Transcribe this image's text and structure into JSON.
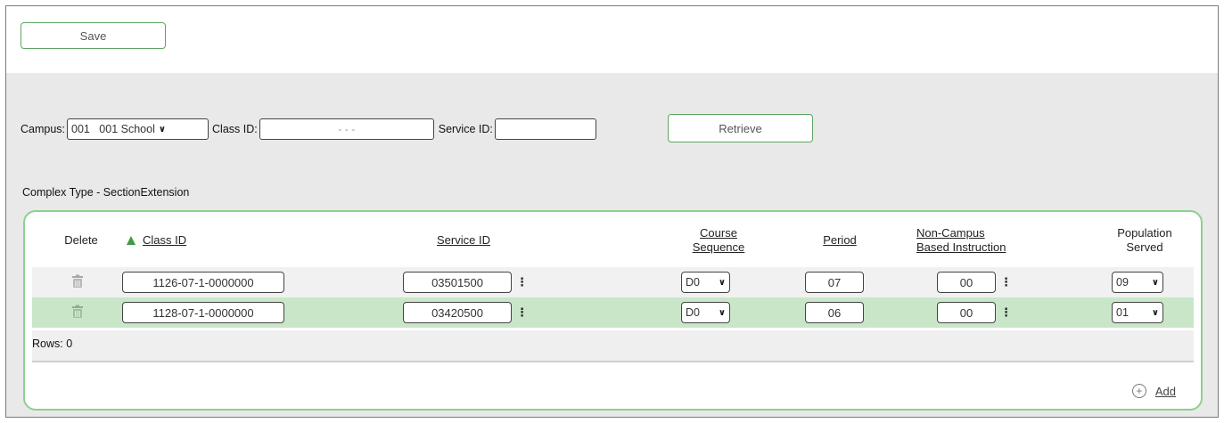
{
  "toolbar": {
    "save_label": "Save"
  },
  "filters": {
    "campus_label": "Campus:",
    "campus_value": "001   001 School",
    "class_id_label": "Class ID:",
    "class_id_placeholder": "- - -",
    "service_id_label": "Service ID:",
    "service_id_value": "",
    "retrieve_label": "Retrieve"
  },
  "section_title": "Complex Type - SectionExtension",
  "table": {
    "headers": {
      "delete": "Delete",
      "class_id": "Class ID",
      "service_id": "Service ID",
      "course_sequence_1": "Course",
      "course_sequence_2": "Sequence",
      "period": "Period",
      "non_campus_1": "Non-Campus",
      "non_campus_2": "Based Instruction",
      "population_1": "Population",
      "population_2": "Served"
    },
    "sort_indicator": "ascending",
    "rows": [
      {
        "class_id": "1126-07-1-0000000",
        "service_id": "03501500",
        "course_sequence": "D0",
        "period": "07",
        "non_campus": "00",
        "population_served": "09"
      },
      {
        "class_id": "1128-07-1-0000000",
        "service_id": "03420500",
        "course_sequence": "D0",
        "period": "06",
        "non_campus": "00",
        "population_served": "01"
      }
    ],
    "rows_label": "Rows: 0",
    "add_label": "Add"
  },
  "icons": {
    "trash": "trash-icon",
    "dots": "vertical-ellipsis-icon",
    "chevron": "chevron-down-icon",
    "add": "plus-circle-icon",
    "sort": "sort-ascending-icon"
  },
  "colors": {
    "accent": "#5fa463",
    "panel_border": "#8cd08f",
    "selected_row": "#c9e6c9",
    "sort_arrow": "#3f9a45"
  }
}
